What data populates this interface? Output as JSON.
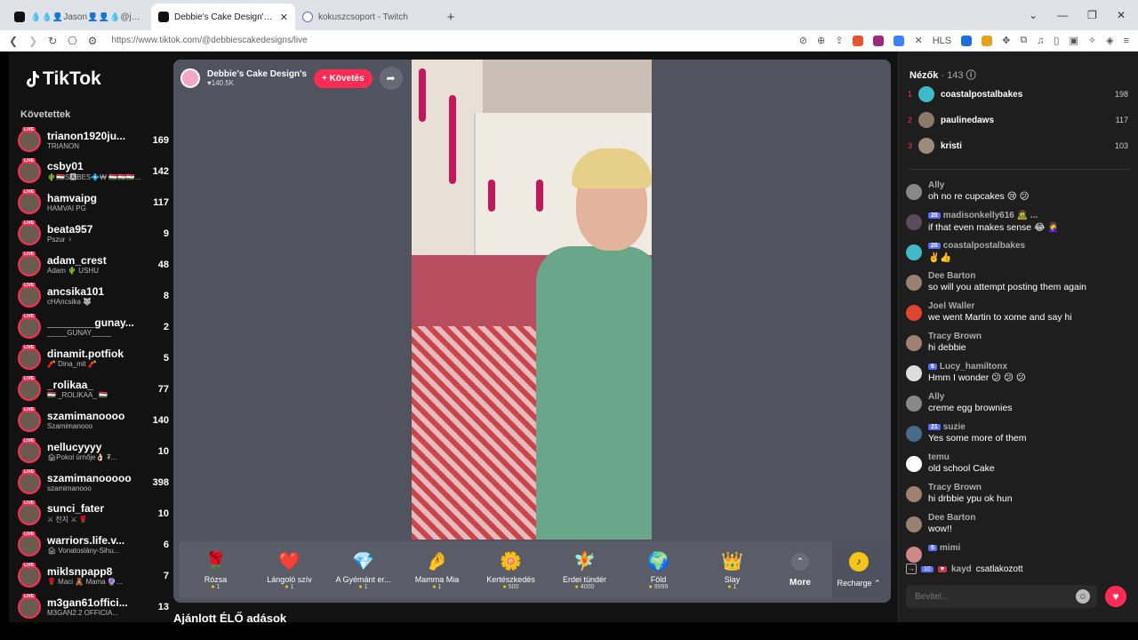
{
  "browser": {
    "tabs": [
      {
        "title": "💧💧👤Jason👤👤💧@jason_sm"
      },
      {
        "title": "Debbie's Cake Design's (@de"
      },
      {
        "title": "kokuszcsoport - Twitch"
      }
    ],
    "url": "https://www.tiktok.com/@debbiescakedesigns/live"
  },
  "sidebar": {
    "logo": "TikTok",
    "section_title": "Követettek",
    "accounts": [
      {
        "name": "trianon1920ju...",
        "sub": "TRIANON",
        "count": "169"
      },
      {
        "name": "csby01",
        "sub": "🌵🇭🇺S🅰BES💠₩ 🇭🇺🇭🇺🇭🇺...",
        "count": "142"
      },
      {
        "name": "hamvaipg",
        "sub": "HAMVAI PG",
        "count": "117"
      },
      {
        "name": "beata957",
        "sub": "Pszur ♀",
        "count": "9"
      },
      {
        "name": "adam_crest",
        "sub": "Adam 🌵 USHU",
        "count": "48"
      },
      {
        "name": "ancsika101",
        "sub": "cHAncsika 🐺",
        "count": "8"
      },
      {
        "name": "________gunay...",
        "sub": "_____GUNAY_____",
        "count": "2"
      },
      {
        "name": "dinamit.potfiok",
        "sub": "🧨 Dina_mit 🧨",
        "count": "5"
      },
      {
        "name": "_rolikaa_",
        "sub": "🇭🇺 _ROLIKAA_ 🇭🇺",
        "count": "77"
      },
      {
        "name": "szamimanoooo",
        "sub": "Szamimanooo",
        "count": "140"
      },
      {
        "name": "nellucyyyy",
        "sub": "🏚Pokol úrnője👌🏻 ₮...",
        "count": "10"
      },
      {
        "name": "szamimanooooo",
        "sub": "szamimanooo",
        "count": "398"
      },
      {
        "name": "sunci_fater",
        "sub": "⚔ 천지 ⚔ 🌹",
        "count": "10"
      },
      {
        "name": "warriors.life.v...",
        "sub": "🏚 Vonatoslány-Sihu...",
        "count": "6"
      },
      {
        "name": "miklsnpapp8",
        "sub": "🌹 Maci 🧸 Mama 🔮...",
        "count": "7"
      },
      {
        "name": "m3gan61offici...",
        "sub": "M3GAN2.2 OFFICIA...",
        "count": "13"
      }
    ]
  },
  "stream": {
    "host_name": "Debbie's Cake Design's",
    "host_likes": "♥140.5K",
    "follow_label": "+ Követés",
    "gifts": [
      {
        "name": "Rózsa",
        "price": "1",
        "icon": "🌹"
      },
      {
        "name": "Lángoló szív",
        "price": "1",
        "icon": "❤️"
      },
      {
        "name": "A Gyémánt er...",
        "price": "1",
        "icon": "💎"
      },
      {
        "name": "Mamma Mia",
        "price": "1",
        "icon": "🤌"
      },
      {
        "name": "Kertészkedés",
        "price": "500",
        "icon": "🌼"
      },
      {
        "name": "Erdei tündér",
        "price": "4000",
        "icon": "🧚"
      },
      {
        "name": "Föld",
        "price": "9999",
        "icon": "🌍"
      },
      {
        "name": "Slay",
        "price": "1",
        "icon": "👑"
      }
    ],
    "more_label": "More",
    "recharge_label": "Recharge ⌃",
    "recommend_title": "Ajánlott ÉLŐ adások"
  },
  "chat": {
    "viewers_label": "Nézők",
    "viewers_count": "· 143",
    "top_viewers": [
      {
        "rank": "1",
        "name": "coastalpostalbakes",
        "score": "198"
      },
      {
        "rank": "2",
        "name": "paulinedaws",
        "score": "117"
      },
      {
        "rank": "3",
        "name": "kristi",
        "score": "103"
      }
    ],
    "messages": [
      {
        "user": "Ally",
        "badge": "",
        "text": "oh no re cupcakes 😢 😕"
      },
      {
        "user": "madisonkelly616 🧟 ...",
        "badge": "20",
        "text": "if that even makes sense 😂 🤦‍♀️"
      },
      {
        "user": "coastalpostalbakes",
        "badge": "20",
        "text": "✌️👍"
      },
      {
        "user": "Dee Barton",
        "badge": "",
        "text": "so will you attempt posting them again"
      },
      {
        "user": "Joel Waller",
        "badge": "",
        "text": "we went Martin to xome and say hi"
      },
      {
        "user": "Tracy Brown",
        "badge": "",
        "text": "hi debbie"
      },
      {
        "user": "Lucy_hamiltonx",
        "badge": "6",
        "text": "Hmm I wonder 😕 😕 😕"
      },
      {
        "user": "Ally",
        "badge": "",
        "text": "creme egg brownies"
      },
      {
        "user": "suzie",
        "badge": "21",
        "text": "Yes some more of them"
      },
      {
        "user": "temu",
        "badge": "",
        "text": "old school Cake"
      },
      {
        "user": "Tracy Brown",
        "badge": "",
        "text": "hi drbbie ypu ok hun"
      },
      {
        "user": "Dee Barton",
        "badge": "",
        "text": "wow!!"
      },
      {
        "user": "mimi",
        "badge": "5",
        "text": ""
      }
    ],
    "join": {
      "badge": "10",
      "user": "kayd",
      "action": "csatlakozott"
    },
    "input_placeholder": "Bevitel..."
  }
}
